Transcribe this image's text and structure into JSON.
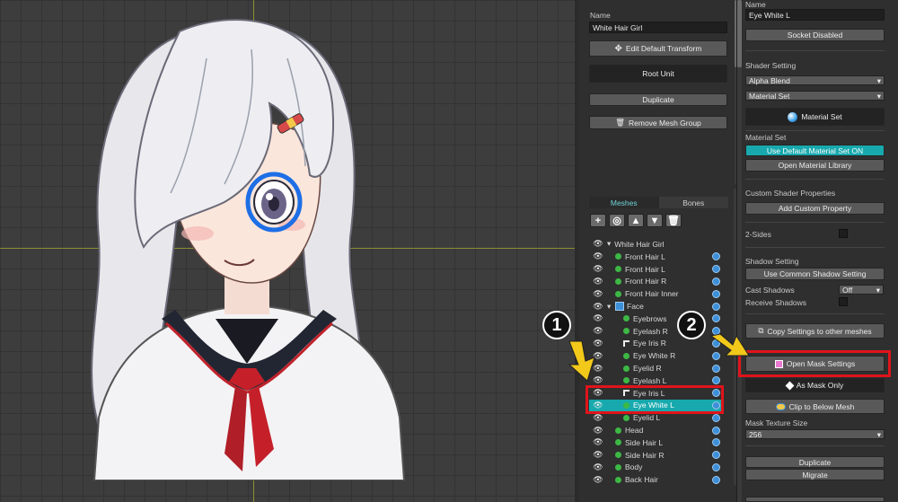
{
  "mid": {
    "name_label": "Name",
    "name_value": "White Hair Girl",
    "edit_default_transform": "Edit Default Transform",
    "root_unit": "Root Unit",
    "duplicate": "Duplicate",
    "remove_mesh_group": "Remove Mesh Group",
    "tab_meshes": "Meshes",
    "tab_bones": "Bones"
  },
  "tree": {
    "root": "White Hair Girl",
    "items": [
      {
        "label": "Front Hair L",
        "kind": "mesh"
      },
      {
        "label": "Front Hair L",
        "kind": "mesh"
      },
      {
        "label": "Front Hair R",
        "kind": "mesh"
      },
      {
        "label": "Front Hair Inner",
        "kind": "mesh"
      },
      {
        "label": "Face",
        "kind": "group"
      },
      {
        "label": "Eyebrows",
        "kind": "mesh"
      },
      {
        "label": "Eyelash R",
        "kind": "mesh"
      },
      {
        "label": "Eye Iris R",
        "kind": "clip"
      },
      {
        "label": "Eye White R",
        "kind": "mesh"
      },
      {
        "label": "Eyelid R",
        "kind": "mesh"
      },
      {
        "label": "Eyelash L",
        "kind": "mesh"
      },
      {
        "label": "Eye Iris L",
        "kind": "clip"
      },
      {
        "label": "Eye White L",
        "kind": "mesh"
      },
      {
        "label": "Eyelid L",
        "kind": "mesh"
      },
      {
        "label": "Head",
        "kind": "mesh"
      },
      {
        "label": "Side Hair L",
        "kind": "mesh"
      },
      {
        "label": "Side Hair R",
        "kind": "mesh"
      },
      {
        "label": "Body",
        "kind": "mesh"
      },
      {
        "label": "Back Hair",
        "kind": "mesh"
      }
    ]
  },
  "right": {
    "name_label": "Name",
    "name_value": "Eye White L",
    "socket": "Socket Disabled",
    "shader_setting": "Shader Setting",
    "alpha_blend": "Alpha Blend",
    "material_set_dd": "Material Set",
    "material_set_btn": "Material Set",
    "material_set_label": "Material Set",
    "use_default": "Use Default Material Set ON",
    "open_library": "Open Material Library",
    "custom_shader": "Custom Shader Properties",
    "add_custom": "Add Custom Property",
    "two_sides": "2-Sides",
    "shadow_setting": "Shadow Setting",
    "use_common_shadow": "Use Common Shadow Setting",
    "cast_shadows": "Cast Shadows",
    "cast_value": "Off",
    "receive_shadows": "Receive Shadows",
    "copy_settings": "Copy Settings to other meshes",
    "open_mask": "Open Mask Settings",
    "as_mask": "As Mask Only",
    "clip_below": "Clip to Below Mesh",
    "mask_texture_size": "Mask Texture Size",
    "mask_size_value": "256",
    "duplicate": "Duplicate",
    "migrate": "Migrate"
  },
  "annotations": {
    "num1": "1",
    "num2": "2"
  },
  "colors": {
    "selected": "#17a9ad",
    "highlight": "#e0141b",
    "arrow": "#f2c81a"
  }
}
